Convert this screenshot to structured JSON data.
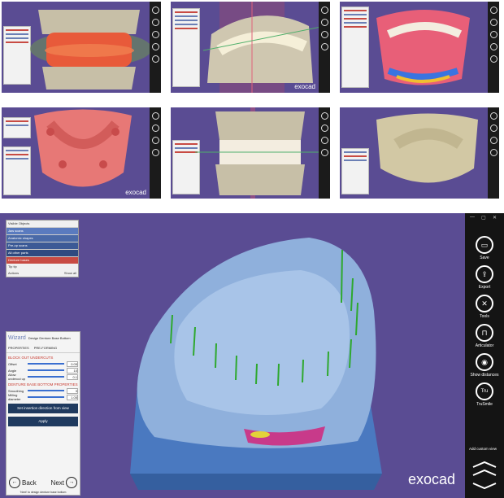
{
  "logo": "exocad",
  "thumbnails": [
    {
      "id": "model-articulation",
      "has_logo": false
    },
    {
      "id": "teeth-setup",
      "has_logo": true
    },
    {
      "id": "gingiva-setup",
      "has_logo": false
    },
    {
      "id": "upper-teeth",
      "has_logo": true
    },
    {
      "id": "occlusion-check",
      "has_logo": false
    },
    {
      "id": "denture-base",
      "has_logo": false
    }
  ],
  "object_list": {
    "header": "Visible Objects",
    "rows": [
      {
        "label": "Jaw scans",
        "color": "#5a7bbf"
      },
      {
        "label": "Anatomic shapes",
        "color": "#4a6aa8"
      },
      {
        "label": "Pre-op scans",
        "color": "#3c5a96"
      },
      {
        "label": "All other parts",
        "color": "#2f4a80"
      },
      {
        "label": "Denture bases",
        "color": "#c84b43"
      }
    ],
    "tip": "Tip tip",
    "footer_left": "Actions",
    "footer_right": "Show all"
  },
  "wizard": {
    "title": "Wizard",
    "step": "Design Denture Base Bottom",
    "tabs": [
      "PROPERTIES",
      "PRE-FORMING"
    ],
    "section1": "BLOCK OUT UNDERCUTS",
    "rows1": [
      {
        "label": "Offset",
        "value": "0.05"
      },
      {
        "label": "Angle",
        "value": "10"
      },
      {
        "label": "Allow undercut up",
        "value": "0.1"
      }
    ],
    "section2": "DENTURE BASE BOTTOM PROPERTIES",
    "rows2": [
      {
        "label": "Smoothing",
        "value": "3"
      },
      {
        "label": "Milling diameter",
        "value": "1.05"
      }
    ],
    "btn_insertion": "Set insertion direction from view",
    "btn_apply": "Apply",
    "back": "Back",
    "next": "Next",
    "hint": "'Next' to design denture base bottom"
  },
  "toolbar": {
    "items": [
      {
        "label": "Save",
        "icon": "save-icon",
        "glyph": "▭"
      },
      {
        "label": "Export",
        "icon": "export-icon",
        "glyph": "⇪"
      },
      {
        "label": "Tools",
        "icon": "tools-icon",
        "glyph": "✕"
      },
      {
        "label": "Articulator",
        "icon": "articulator-icon",
        "glyph": "⊓"
      },
      {
        "label": "Show distances",
        "icon": "distances-icon",
        "glyph": "◉"
      },
      {
        "label": "TruSmile",
        "icon": "trusmile-icon",
        "glyph": "Tru"
      }
    ],
    "add_view": "Add custom view"
  }
}
